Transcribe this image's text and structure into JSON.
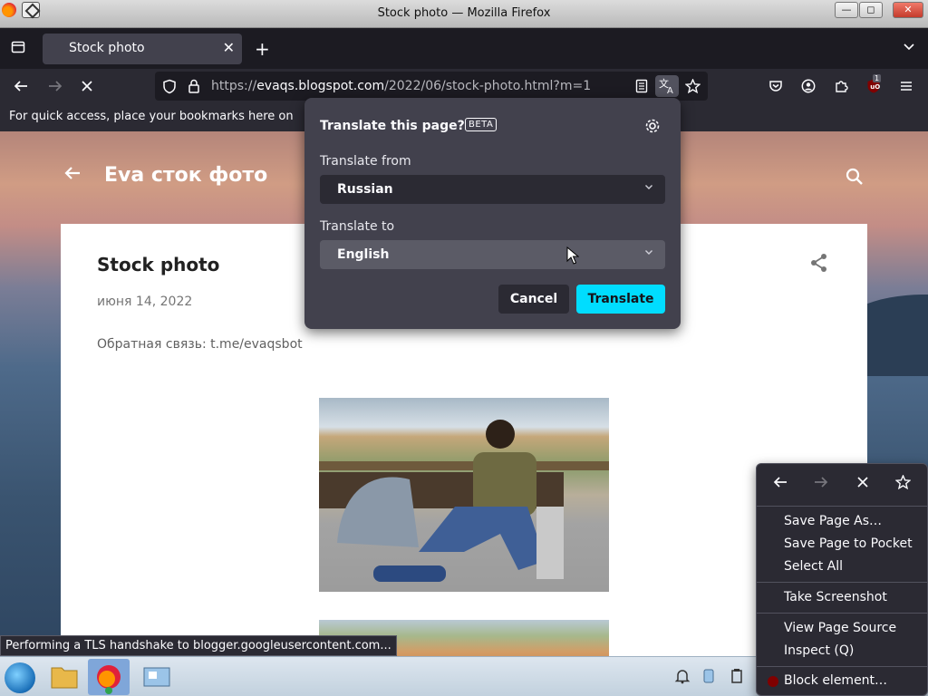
{
  "window": {
    "title": "Stock photo — Mozilla Firefox"
  },
  "tabs": [
    {
      "label": "Stock photo"
    }
  ],
  "urlbar": {
    "url_scheme": "https://",
    "url_host": "evaqs.blogspot.com",
    "url_path": "/2022/06/stock-photo.html?m=1"
  },
  "bookmarks_bar": {
    "message": "For quick access, place your bookmarks here on"
  },
  "blog": {
    "title": "Eva сток фото"
  },
  "post": {
    "title": "Stock photo",
    "date": "июня 14, 2022",
    "body": "Обратная связь: t.me/evaqsbot"
  },
  "translate_panel": {
    "heading": "Translate this page?",
    "badge": "BETA",
    "from_label": "Translate from",
    "from_value": "Russian",
    "to_label": "Translate to",
    "to_value": "English",
    "cancel_label": "Cancel",
    "translate_label": "Translate"
  },
  "status_text": "Performing a TLS handshake to blogger.googleusercontent.com...",
  "context_menu": {
    "items": [
      "Save Page As…",
      "Save Page to Pocket",
      "Select All",
      "Take Screenshot",
      "View Page Source",
      "Inspect (Q)",
      "Block element…"
    ]
  },
  "extensions": {
    "ublock_badge": "1"
  },
  "colors": {
    "accent": "#00ddff",
    "toolbar": "#2b2a33",
    "panel": "#42414d"
  }
}
